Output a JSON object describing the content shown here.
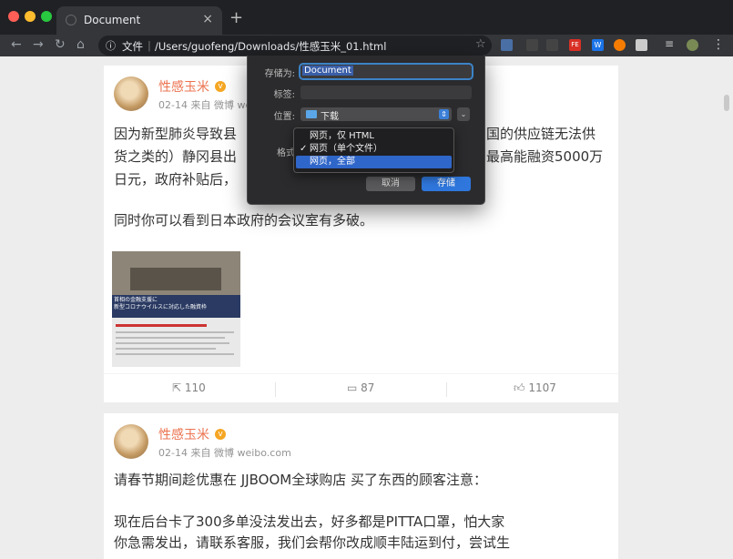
{
  "browser": {
    "tab_title": "Document",
    "address_label": "文件",
    "url": "/Users/guofeng/Downloads/性感玉米_01.html",
    "extensions": [
      "FE",
      "W"
    ]
  },
  "posts": [
    {
      "username": "性感玉米",
      "meta": "02-14 来自 微博 we",
      "lines": [
        "因为新型肺炎导致县",
        "货之类的）静冈县出",
        "日元，政府补贴后，",
        "",
        "同时你可以看到日本政府的会议室有多破。"
      ],
      "lines_right": [
        "国的供应链无法供",
        "最高能融资5000万",
        ""
      ],
      "thumb_caption": [
        "首相の金融支援に",
        "新型コロナウイルスに対応した融資枠"
      ],
      "reposts": "110",
      "comments": "87",
      "likes": "1107"
    },
    {
      "username": "性感玉米",
      "meta": "02-14 来自 微博 weibo.com",
      "lines": [
        "请春节期间趁优惠在 JJBOOM全球购店 买了东西的顾客注意：",
        "",
        "现在后台卡了300多单没法发出去，好多都是PITTA口罩，怕大家",
        "你急需发出，请联系客服，我们会帮你改成顺丰陆运到付，尝试生"
      ]
    }
  ],
  "save_dialog": {
    "save_as_label": "存储为:",
    "save_as_value": "Document",
    "tags_label": "标签:",
    "location_label": "位置:",
    "location_value": "下载",
    "format_label": "格式",
    "cancel_label": "取消",
    "save_label": "存储",
    "format_options": [
      "网页，仅 HTML",
      "网页（单个文件）",
      "网页，全部"
    ],
    "checked_option": "✓",
    "highlighted_option_index": 2
  },
  "colors": {
    "accent": "#2f66c9",
    "username": "#eb7350",
    "chrome_dark": "#202124"
  }
}
